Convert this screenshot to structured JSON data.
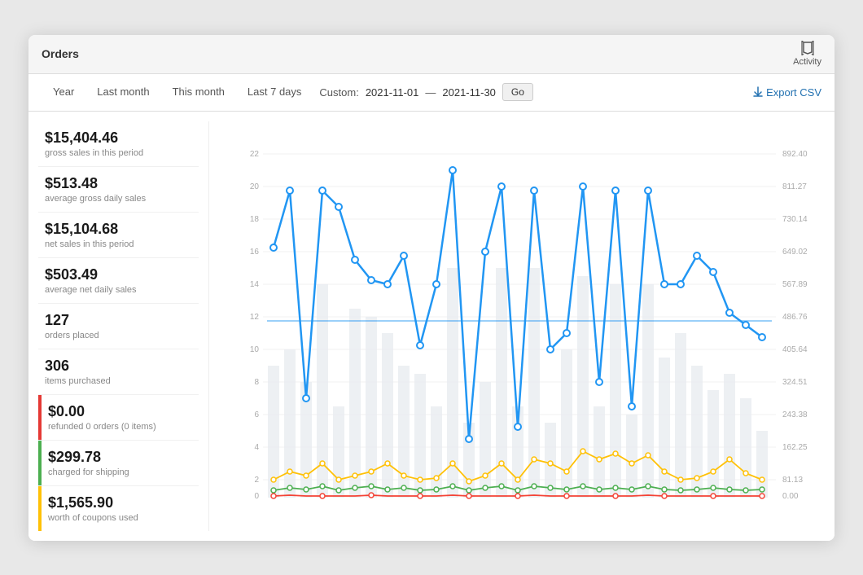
{
  "header": {
    "title": "Orders",
    "activity_label": "Activity"
  },
  "tabs": [
    {
      "id": "year",
      "label": "Year",
      "active": false
    },
    {
      "id": "last-month",
      "label": "Last month",
      "active": false
    },
    {
      "id": "this-month",
      "label": "This month",
      "active": false
    },
    {
      "id": "last-7-days",
      "label": "Last 7 days",
      "active": false
    }
  ],
  "custom": {
    "label": "Custom:",
    "date_from": "2021-11-01",
    "dash": "—",
    "date_to": "2021-11-30",
    "go_label": "Go"
  },
  "export_label": "Export CSV",
  "stats": [
    {
      "value": "$15,404.46",
      "label": "gross sales in this period",
      "bar_color": null
    },
    {
      "value": "$513.48",
      "label": "average gross daily sales",
      "bar_color": null
    },
    {
      "value": "$15,104.68",
      "label": "net sales in this period",
      "bar_color": null
    },
    {
      "value": "$503.49",
      "label": "average net daily sales",
      "bar_color": null
    },
    {
      "value": "127",
      "label": "orders placed",
      "bar_color": null
    },
    {
      "value": "306",
      "label": "items purchased",
      "bar_color": null
    },
    {
      "value": "$0.00",
      "label": "refunded 0 orders (0 items)",
      "bar_color": "#e53935"
    },
    {
      "value": "$299.78",
      "label": "charged for shipping",
      "bar_color": "#4CAF50"
    },
    {
      "value": "$1,565.90",
      "label": "worth of coupons used",
      "bar_color": "#FFC107"
    }
  ],
  "chart": {
    "y_left_labels": [
      "22",
      "20",
      "18",
      "16",
      "14",
      "12",
      "10",
      "8",
      "6",
      "4",
      "2",
      "0"
    ],
    "y_right_labels": [
      "892.40",
      "811.27",
      "730.14",
      "649.02",
      "567.89",
      "486.76",
      "405.64",
      "324.51",
      "243.38",
      "162.25",
      "81.13",
      "0.00"
    ]
  }
}
